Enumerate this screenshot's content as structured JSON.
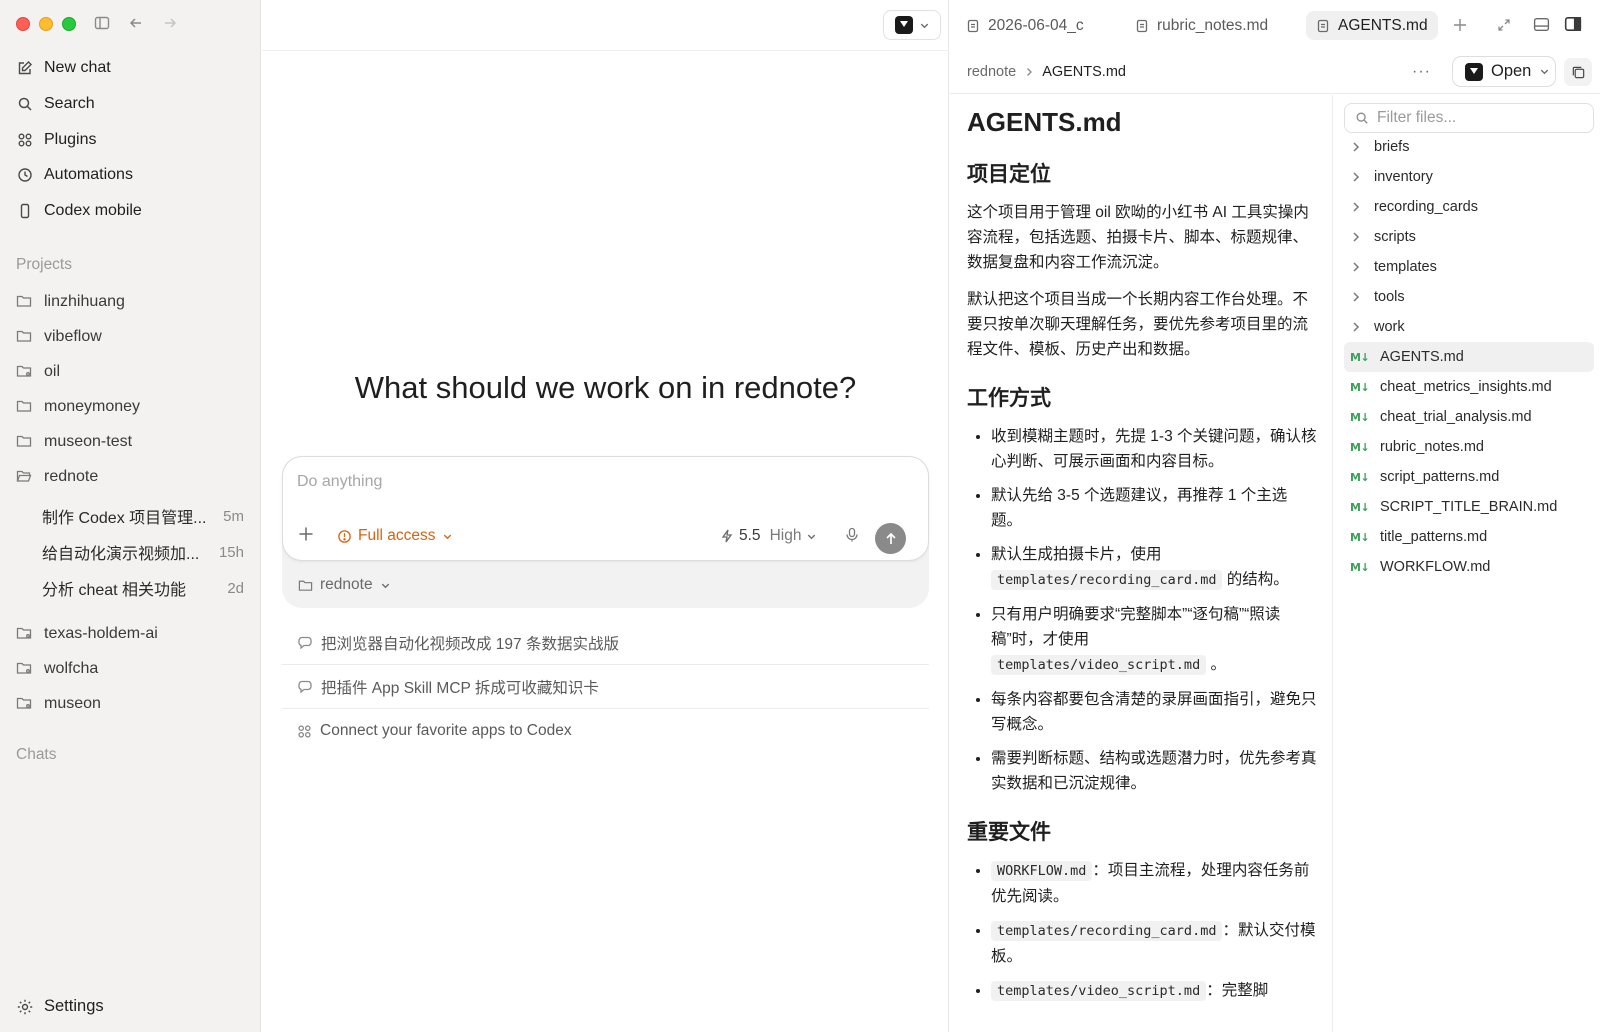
{
  "sidebar": {
    "nav": [
      {
        "label": "New chat",
        "icon": "edit-icon"
      },
      {
        "label": "Search",
        "icon": "search-icon"
      },
      {
        "label": "Plugins",
        "icon": "grid-icon"
      },
      {
        "label": "Automations",
        "icon": "clock-icon"
      },
      {
        "label": "Codex mobile",
        "icon": "phone-icon"
      }
    ],
    "projects_label": "Projects",
    "projects": [
      {
        "label": "linzhihuang"
      },
      {
        "label": "vibeflow"
      },
      {
        "label": "oil"
      },
      {
        "label": "moneymoney"
      },
      {
        "label": "museon-test"
      },
      {
        "label": "rednote"
      }
    ],
    "chats_in_project": [
      {
        "title": "制作 Codex 项目管理...",
        "age": "5m"
      },
      {
        "title": "给自动化演示视频加...",
        "age": "15h"
      },
      {
        "title": "分析 cheat 相关功能",
        "age": "2d"
      }
    ],
    "more_projects": [
      {
        "label": "texas-holdem-ai"
      },
      {
        "label": "wolfcha"
      },
      {
        "label": "museon"
      }
    ],
    "chats_label": "Chats",
    "settings_label": "Settings"
  },
  "main": {
    "hero": "What should we work on in rednote?",
    "composer": {
      "placeholder": "Do anything",
      "access": "Full access",
      "model": "5.5",
      "effort": "High"
    },
    "workspace": "rednote",
    "suggestions": [
      "把浏览器自动化视频改成 197 条数据实战版",
      "把插件 App Skill MCP 拆成可收藏知识卡",
      "Connect your favorite apps to Codex"
    ]
  },
  "panel": {
    "tabs": [
      "2026-06-04_c",
      "rubric_notes.md",
      "AGENTS.md"
    ],
    "breadcrumb": [
      "rednote",
      "AGENTS.md"
    ],
    "open_label": "Open",
    "doc": {
      "title": "AGENTS.md",
      "h_position": "项目定位",
      "p1": "这个项目用于管理 oil 欧呦的小红书 AI 工具实操内容流程，包括选题、拍摄卡片、脚本、标题规律、数据复盘和内容工作流沉淀。",
      "p2": "默认把这个项目当成一个长期内容工作台处理。不要只按单次聊天理解任务，要优先参考项目里的流程文件、模板、历史产出和数据。",
      "h_method": "工作方式",
      "m1": "收到模糊主题时，先提 1-3 个关键问题，确认核心判断、可展示画面和内容目标。",
      "m2": "默认先给 3-5 个选题建议，再推荐 1 个主选题。",
      "m3a": "默认生成拍摄卡片，使用",
      "m3code": "templates/recording_card.md",
      "m3b": "的结构。",
      "m4a": "只有用户明确要求“完整脚本”“逐句稿”“照读稿”时，才使用",
      "m4code": "templates/video_script.md",
      "m4b": "。",
      "m5": "每条内容都要包含清楚的录屏画面指引，避免只写概念。",
      "m6": "需要判断标题、结构或选题潜力时，优先参考真实数据和已沉淀规律。",
      "h_files": "重要文件",
      "f1code": "WORKFLOW.md",
      "f1": "：项目主流程，处理内容任务前优先阅读。",
      "f2code": "templates/recording_card.md",
      "f2": "：默认交付模板。",
      "f3code": "templates/video_script.md",
      "f3": "：完整脚"
    },
    "filter_placeholder": "Filter files...",
    "folders": [
      "briefs",
      "inventory",
      "recording_cards",
      "scripts",
      "templates",
      "tools",
      "work"
    ],
    "md_badge": "M↓",
    "files": [
      "AGENTS.md",
      "cheat_metrics_insights.md",
      "cheat_trial_analysis.md",
      "rubric_notes.md",
      "script_patterns.md",
      "SCRIPT_TITLE_BRAIN.md",
      "title_patterns.md",
      "WORKFLOW.md"
    ]
  }
}
